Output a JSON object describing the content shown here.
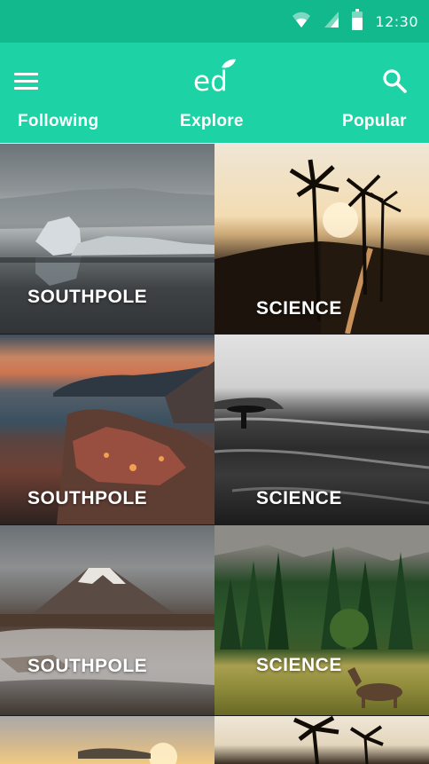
{
  "status_bar": {
    "time": "12:30",
    "icons": [
      "wifi-icon",
      "signal-icon",
      "battery-icon"
    ]
  },
  "app_bar": {
    "logo_text": "ed",
    "menu_icon": "hamburger-icon",
    "search_icon": "search-icon"
  },
  "tabs": [
    {
      "label": "Following",
      "selected": true
    },
    {
      "label": "Explore",
      "selected": false
    },
    {
      "label": "Popular",
      "selected": false
    }
  ],
  "tiles": [
    {
      "label": "SOUTHPOLE"
    },
    {
      "label": "SCIENCE"
    },
    {
      "label": "SOUTHPOLE"
    },
    {
      "label": "SCIENCE"
    },
    {
      "label": "SOUTHPOLE"
    },
    {
      "label": "SCIENCE"
    },
    {
      "label": ""
    },
    {
      "label": ""
    }
  ],
  "colors": {
    "status_bar": "#12b98c",
    "app_bar": "#1dd3a5",
    "text": "#ffffff"
  }
}
